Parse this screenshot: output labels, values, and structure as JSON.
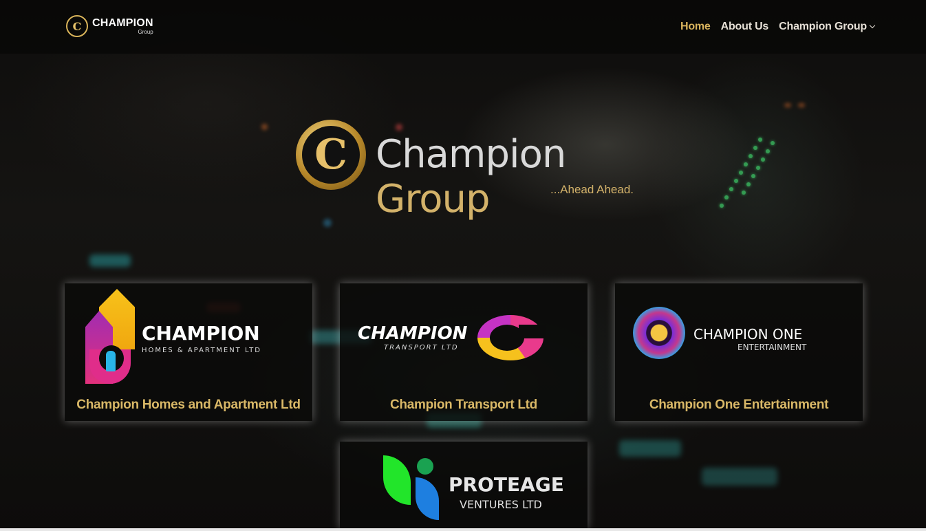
{
  "header": {
    "brand_name": "CHAMPION",
    "brand_sub": "Group",
    "brand_mark": "C"
  },
  "nav": {
    "items": [
      {
        "label": "Home",
        "active": true
      },
      {
        "label": "About Us",
        "active": false
      },
      {
        "label": "Champion Group",
        "active": false,
        "has_dropdown": true
      }
    ]
  },
  "hero": {
    "logo_letter": "C",
    "title_part1": "Champion",
    "title_part2": "Group",
    "tagline": "...Ahead Ahead."
  },
  "companies": [
    {
      "title": "Champion Homes and Apartment Ltd",
      "logo_big": "CHAMPION",
      "logo_small": "HOMES & APARTMENT LTD"
    },
    {
      "title": "Champion Transport Ltd",
      "logo_big": "CHAMPION",
      "logo_small": "TRANSPORT LTD"
    },
    {
      "title": "Champion One Entertainment",
      "logo_big": "CHAMPION ONE",
      "logo_small": "ENTERTAINMENT"
    },
    {
      "title": "",
      "logo_big": "PROTEAGE",
      "logo_small": "VENTURES LTD"
    }
  ],
  "colors": {
    "accent_gold": "#d8b35c",
    "nav_text": "#e6e0d6",
    "background": "#0b0a09"
  }
}
